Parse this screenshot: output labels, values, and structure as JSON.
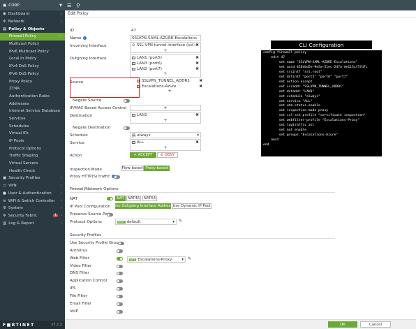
{
  "sidebar": {
    "header": "CORP",
    "items": [
      {
        "label": "Dashboard",
        "icon": "dashboard-icon",
        "type": "group",
        "chev": true
      },
      {
        "label": "Network",
        "icon": "network-icon",
        "type": "group",
        "chev": true
      },
      {
        "label": "Policy & Objects",
        "icon": "policy-icon",
        "type": "group-open",
        "chev": false
      },
      {
        "label": "Firewall Policy",
        "type": "active",
        "star": true
      },
      {
        "label": "Multicast Policy",
        "type": "sub"
      },
      {
        "label": "IPv6 Multicast Policy",
        "type": "sub"
      },
      {
        "label": "Local In Policy",
        "type": "sub"
      },
      {
        "label": "IPv4 DoS Policy",
        "type": "sub"
      },
      {
        "label": "IPv6 DoS Policy",
        "type": "sub"
      },
      {
        "label": "Proxy Policy",
        "type": "sub"
      },
      {
        "label": "ZTNA",
        "type": "sub"
      },
      {
        "label": "Authentication Rules",
        "type": "sub"
      },
      {
        "label": "Addresses",
        "type": "sub"
      },
      {
        "label": "Internet Service Database",
        "type": "sub"
      },
      {
        "label": "Services",
        "type": "sub"
      },
      {
        "label": "Schedules",
        "type": "sub"
      },
      {
        "label": "Virtual IPs",
        "type": "sub"
      },
      {
        "label": "IP Pools",
        "type": "sub"
      },
      {
        "label": "Protocol Options",
        "type": "sub"
      },
      {
        "label": "Traffic Shaping",
        "type": "sub"
      },
      {
        "label": "Virtual Servers",
        "type": "sub"
      },
      {
        "label": "Health Check",
        "type": "sub"
      },
      {
        "label": "Security Profiles",
        "icon": "lock-icon",
        "type": "group",
        "chev": true
      },
      {
        "label": "VPN",
        "icon": "vpn-icon",
        "type": "group",
        "chev": true
      },
      {
        "label": "User & Authentication",
        "icon": "user-icon",
        "type": "group",
        "chev": true
      },
      {
        "label": "WiFi & Switch Controller",
        "icon": "wifi-icon",
        "type": "group",
        "chev": true
      },
      {
        "label": "System",
        "icon": "gear-icon",
        "type": "group",
        "chev": true
      },
      {
        "label": "Security Fabric",
        "icon": "fabric-icon",
        "type": "group",
        "chev": true,
        "badge": "1"
      },
      {
        "label": "Log & Report",
        "icon": "chart-icon",
        "type": "group",
        "chev": true
      }
    ],
    "logo": "F■RTINET",
    "version": "v7.2.2"
  },
  "header": {
    "title": "Edit Policy"
  },
  "form": {
    "id_label": "ID",
    "id_value": "47",
    "name_label": "Name",
    "name_value": "SSLVPN-SAML-AZURE-Escalations",
    "incoming_label": "Incoming Interface",
    "incoming_value": "SSL-VPN tunnel interface (ssl.roo",
    "outgoing_label": "Outgoing Interface",
    "outgoing_values": [
      "LAN1 (port5)",
      "LAN3 (port6)",
      "LAN2 (port7)"
    ],
    "source_label": "Source",
    "source_values": [
      "SSLVPN_TUNNEL_ADDR1",
      "Escalations-Azure"
    ],
    "negate_source_label": "Negate Source",
    "ipmac_label": "IP/MAC Based Access Control",
    "destination_label": "Destination",
    "destination_value": "LAN1",
    "negate_destination_label": "Negate Destination",
    "schedule_label": "Schedule",
    "schedule_value": "always",
    "service_label": "Service",
    "service_value": "ALL",
    "action_label": "Action",
    "accept_label": "✔ ACCEPT",
    "deny_label": "⊘ DENY",
    "inspection_label": "Inspection Mode",
    "flow_label": "Flow-based",
    "proxy_label": "Proxy-based",
    "proxy_http_label": "Proxy HTTP(S) traffic",
    "plus": "+",
    "x": "✖"
  },
  "nat_section": {
    "title": "Firewall/Network Options",
    "nat_label": "NAT",
    "nat_tabs": [
      "NAT",
      "NAT46",
      "NAT64"
    ],
    "ippool_label": "IP Pool Configuration",
    "ippool_options": [
      "Use Outgoing Interface Address",
      "Use Dynamic IP Pool"
    ],
    "preserve_label": "Preserve Source Port",
    "protocol_label": "Protocol Options",
    "protocol_tag": "PROT",
    "protocol_value": "default"
  },
  "security_section": {
    "title": "Security Profiles",
    "items": [
      "Use Security Profile Group",
      "AntiVirus",
      "Web Filter",
      "Video Filter",
      "DNS Filter",
      "Application Control",
      "IPS",
      "File Filter",
      "Email Filter",
      "VoIP"
    ],
    "webfilter_tag": "WEB",
    "webfilter_value": "Escalations-Proxy"
  },
  "cli": {
    "title": "CLI Configuration",
    "text": "config firewall policy\n    edit 47\n        set name \"SSLVPN-SAML-AZURE-Escalations\"\n        set uuid 456ebd5e-9e5a-51ec-247a-de113cf57d7c\n        set srcintf \"ssl.root\"\n        set dstintf \"port5\" \"port6\" \"port7\"\n        set action accept\n        set srcaddr \"SSLVPN_TUNNEL_ADDR1\"\n        set dstaddr \"LAN1\"\n        set schedule \"always\"\n        set service \"ALL\"\n        set utm-status enable\n        set inspection-mode proxy\n        set ssl-ssh-profile \"certificate-inspection\"\n        set webfilter-profile \"Escalations-Proxy\"\n        set logtraffic all\n        set nat enable\n        set groups \"Escalations-Azure\"\n    next\nend"
  },
  "footer": {
    "ok": "OK",
    "cancel": "Cancel"
  },
  "colors": {
    "accent": "#6ca935",
    "sidebar": "#2b3a42",
    "highlight": "#e02020"
  }
}
